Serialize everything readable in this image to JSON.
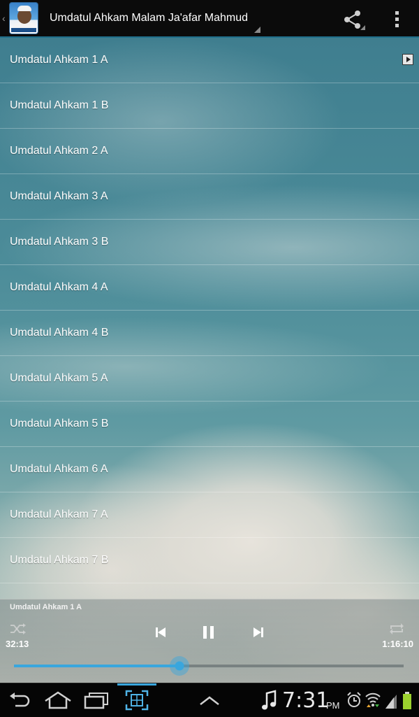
{
  "app_bar": {
    "title": "Umdatul Ahkam Malam Ja'afar Mahmud",
    "icon_name": "app-icon",
    "share_icon": "share-icon",
    "overflow_icon": "overflow-menu-icon"
  },
  "tracks": [
    {
      "label": "Umdatul Ahkam 1 A",
      "playing": true
    },
    {
      "label": "Umdatul Ahkam 1 B",
      "playing": false
    },
    {
      "label": "Umdatul Ahkam 2 A",
      "playing": false
    },
    {
      "label": "Umdatul Ahkam 3 A",
      "playing": false
    },
    {
      "label": "Umdatul Ahkam 3 B",
      "playing": false
    },
    {
      "label": "Umdatul Ahkam 4 A",
      "playing": false
    },
    {
      "label": "Umdatul Ahkam 4 B",
      "playing": false
    },
    {
      "label": "Umdatul Ahkam 5 A",
      "playing": false
    },
    {
      "label": "Umdatul Ahkam 5 B",
      "playing": false
    },
    {
      "label": "Umdatul Ahkam 6 A",
      "playing": false
    },
    {
      "label": "Umdatul Ahkam 7 A",
      "playing": false
    },
    {
      "label": "Umdatul Ahkam 7 B",
      "playing": false
    }
  ],
  "player": {
    "now_playing": "Umdatul Ahkam 1 A",
    "elapsed": "32:13",
    "duration": "1:16:10",
    "progress": 0.425,
    "accent_color": "#39a6dd"
  },
  "system_bar": {
    "time": "7:31",
    "ampm": "PM",
    "icons": [
      "back-icon",
      "home-icon",
      "recent-apps-icon",
      "screenshot-icon",
      "menu-up-icon",
      "music-note-icon",
      "alarm-icon",
      "wifi-icon",
      "signal-icon",
      "battery-icon"
    ]
  }
}
